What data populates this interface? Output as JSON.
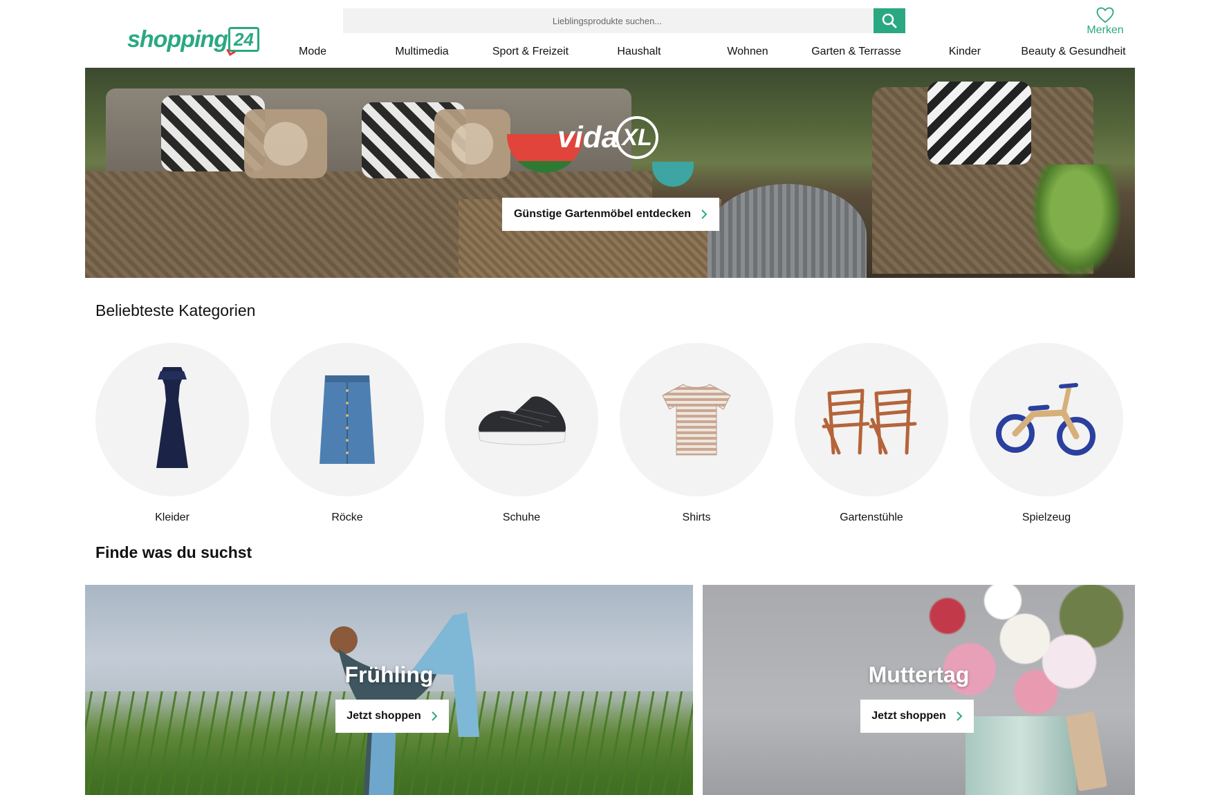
{
  "header": {
    "logo_text": "shopping",
    "logo_badge": "24",
    "search_placeholder": "Lieblingsprodukte suchen...",
    "merken_label": "Merken"
  },
  "nav": [
    "Mode",
    "Multimedia",
    "Sport & Freizeit",
    "Haushalt",
    "Wohnen",
    "Garten & Terrasse",
    "Kinder",
    "Beauty & Gesundheit"
  ],
  "hero": {
    "brand": "vida",
    "brand_badge": "XL",
    "cta_label": "Günstige Gartenmöbel entdecken"
  },
  "categories_title": "Beliebteste Kategorien",
  "categories": [
    "Kleider",
    "Röcke",
    "Schuhe",
    "Shirts",
    "Gartenstühle",
    "Spielzeug"
  ],
  "find_title": "Finde was du suchst",
  "tiles": [
    {
      "title": "Frühling",
      "button": "Jetzt shoppen"
    },
    {
      "title": "Muttertag",
      "button": "Jetzt shoppen"
    }
  ],
  "colors": {
    "brand_green": "#2aa882",
    "logo_accent_red": "#e03a3a"
  }
}
